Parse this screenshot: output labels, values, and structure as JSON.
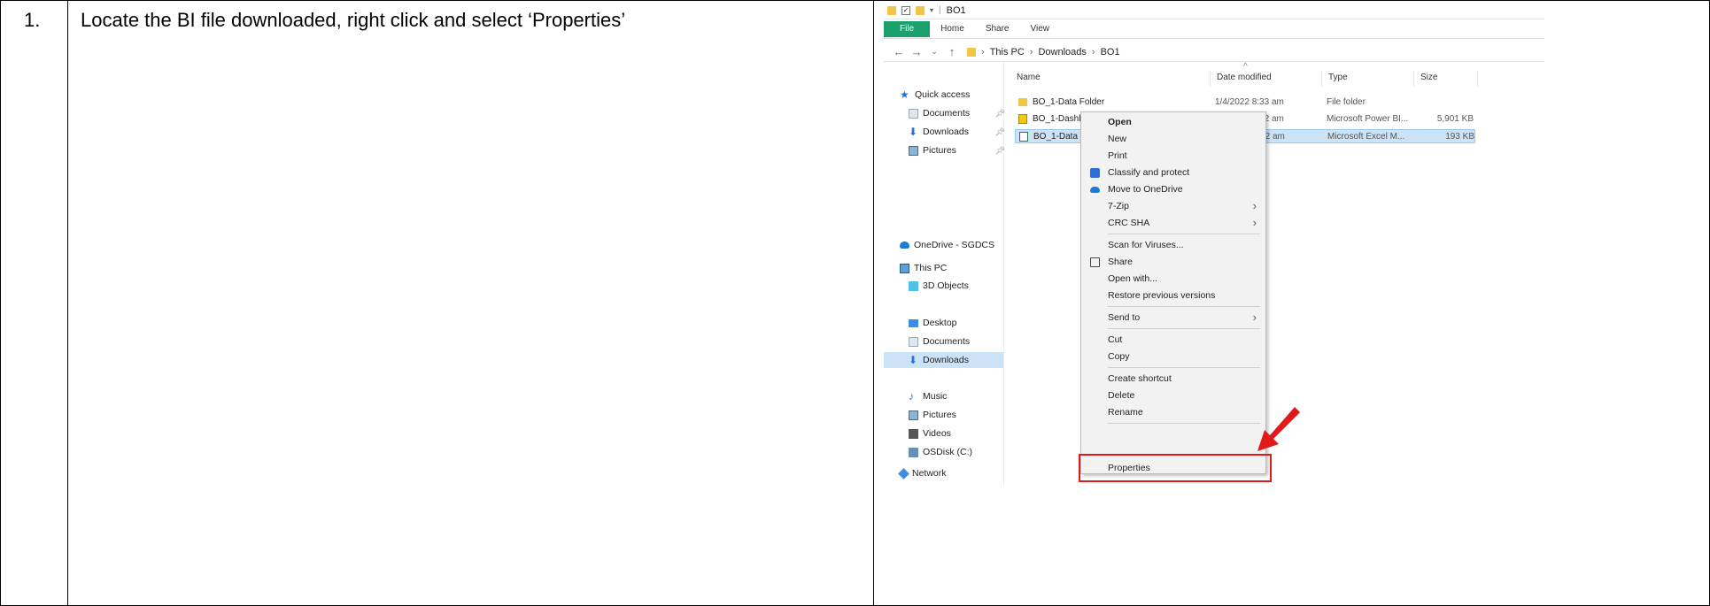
{
  "step": {
    "number": "1.",
    "instruction": "Locate the BI file downloaded, right click and select ‘Properties’"
  },
  "explorer": {
    "window_title": "BO1",
    "ribbon_tabs": [
      "File",
      "Home",
      "Share",
      "View"
    ],
    "breadcrumb": [
      "This PC",
      "Downloads",
      "BO1"
    ],
    "nav_items": [
      {
        "label": "Quick access",
        "icon": "star-icon"
      },
      {
        "label": "Documents",
        "icon": "documents-icon"
      },
      {
        "label": "Downloads",
        "icon": "download-arrow-icon"
      },
      {
        "label": "Pictures",
        "icon": "pictures-icon"
      },
      {
        "label": "OneDrive - SGDCS",
        "icon": "cloud-icon"
      },
      {
        "label": "This PC",
        "icon": "computer-icon"
      },
      {
        "label": "3D Objects",
        "icon": "cube-icon"
      },
      {
        "label": "Desktop",
        "icon": "desktop-icon"
      },
      {
        "label": "Documents",
        "icon": "documents-icon"
      },
      {
        "label": "Downloads",
        "icon": "download-arrow-icon"
      },
      {
        "label": "Music",
        "icon": "music-note-icon"
      },
      {
        "label": "Pictures",
        "icon": "pictures-icon"
      },
      {
        "label": "Videos",
        "icon": "film-icon"
      },
      {
        "label": "OSDisk (C:)",
        "icon": "disk-drive-icon"
      },
      {
        "label": "Network",
        "icon": "network-icon"
      }
    ],
    "columns": [
      "Name",
      "Date modified",
      "Type",
      "Size"
    ],
    "files": [
      {
        "name": "BO_1-Data Folder",
        "date": "1/4/2022 8:33 am",
        "type": "File folder",
        "size": "",
        "icon": "folder-icon"
      },
      {
        "name": "BO_1-Dashboard",
        "date": "1/4/2022 8:32 am",
        "type": "Microsoft Power BI...",
        "size": "5,901 KB",
        "icon": "power-bi-file-icon"
      },
      {
        "name": "BO_1-Data Template",
        "date": "1/4/2022 8:32 am",
        "type": "Microsoft Excel M...",
        "size": "193 KB",
        "icon": "excel-file-icon"
      }
    ],
    "context_menu": [
      {
        "label": "Open",
        "bold": true
      },
      {
        "label": "New"
      },
      {
        "label": "Print"
      },
      {
        "label": "Classify and protect",
        "icon": "protect-icon"
      },
      {
        "label": "Move to OneDrive",
        "icon": "cloud-icon"
      },
      {
        "label": "7-Zip",
        "submenu": true
      },
      {
        "label": "CRC SHA",
        "submenu": true
      },
      {
        "label": "Scan for Viruses..."
      },
      {
        "label": "Share",
        "icon": "share-icon"
      },
      {
        "label": "Open with..."
      },
      {
        "label": "Restore previous versions"
      },
      {
        "label": "Send to",
        "submenu": true
      },
      {
        "label": "Cut"
      },
      {
        "label": "Copy"
      },
      {
        "label": "Create shortcut"
      },
      {
        "label": "Delete"
      },
      {
        "label": "Rename"
      },
      {
        "label": "Properties"
      }
    ]
  },
  "colors": {
    "file_tab": "#19a06c",
    "selection": "#cce3f7",
    "highlight": "#e01a1a"
  }
}
